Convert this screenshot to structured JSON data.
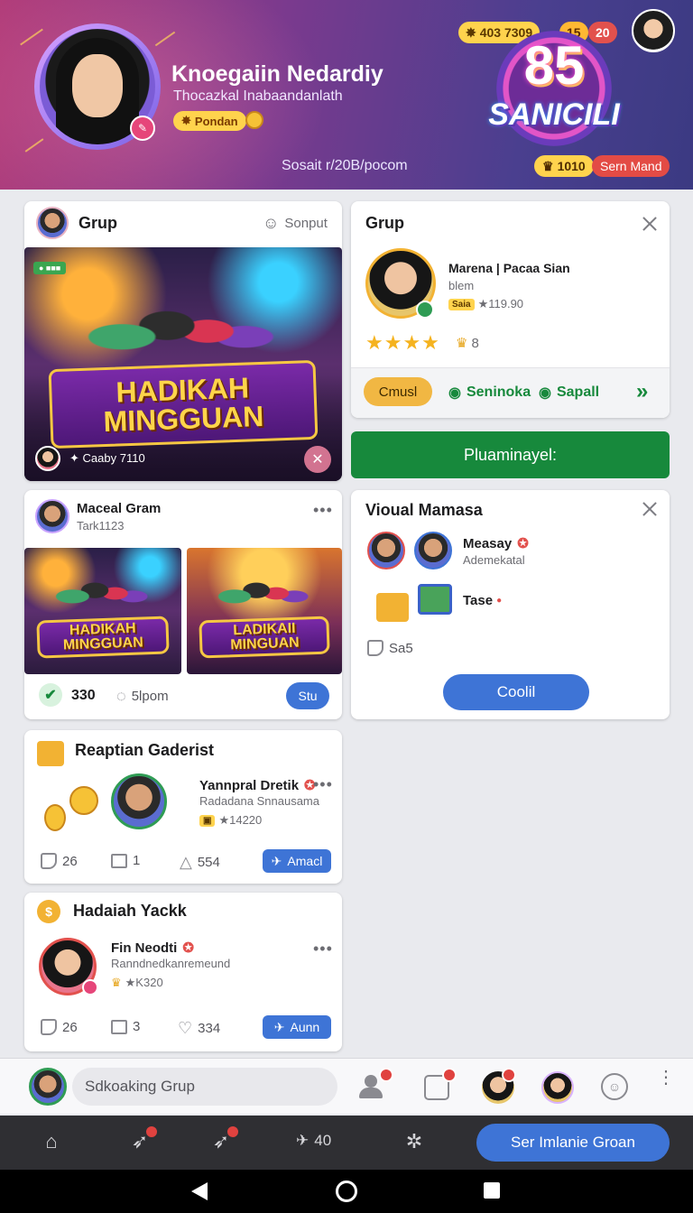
{
  "header": {
    "name": "Knoegaiin Nedardiy",
    "subtitle": "Thocazkal Inabaandanlath",
    "rank_label": "Pondan",
    "url": "Sosait r/20B/pocom",
    "coins": "403 7309",
    "level_a": "15",
    "level_b": "20",
    "score": "85",
    "score_word": "SANICILI",
    "stat_gold": "1010",
    "stat_red_label": "Sern Mand"
  },
  "card_group": {
    "title": "Grup",
    "support_label": "Sonput",
    "banner_line1": "HADIKAH",
    "banner_line2": "MINGGUAN",
    "footer_text": "Caaby 7110"
  },
  "card_profile": {
    "title": "Grup",
    "name": "Marena | Pacaa Sian",
    "sub": "blem",
    "chip": "Saia",
    "points": "★119.90",
    "stars": "★★★★",
    "star_count": "8",
    "bubble": "Cmusl",
    "link1": "Seninoka",
    "link2": "Sapall"
  },
  "green_button": "Pluaminayel:",
  "card_post": {
    "name": "Maceal Gram",
    "sub": "Tark1123",
    "img1_line1": "HADIKAH",
    "img1_line2": "MINGGUAN",
    "img2_line1": "LADIKAII",
    "img2_line2": "MINGUAN",
    "like_count": "330",
    "comment_label": "5lpom",
    "button": "Stu"
  },
  "card_visual": {
    "title": "Vioual Mamasa",
    "name": "Measay",
    "sub": "Ademekatal",
    "item": "Tase",
    "like_label": "Sa5",
    "button": "Coolil"
  },
  "card_reward": {
    "title": "Reaptian Gaderist",
    "name": "Yannpral Dretik",
    "sub": "Radadana Snnausama",
    "points": "★14220",
    "likes": "26",
    "shares": "1",
    "hearts": "554",
    "button": "Amacl"
  },
  "card_weekly": {
    "title": "Hadaiah Yackk",
    "name": "Fin Neodti",
    "sub": "Ranndnedkanremeund",
    "points": "★K320",
    "likes": "26",
    "shares": "3",
    "hearts": "334",
    "button": "Aunn"
  },
  "compose": {
    "placeholder": "Sdkoaking Grup"
  },
  "nav": {
    "tweet_count": "40",
    "cta": "Ser Imlanie Groan"
  },
  "colors": {
    "accent": "#3e74d6",
    "green": "#17893c",
    "gold": "#ffd34d",
    "red": "#e0423f"
  }
}
